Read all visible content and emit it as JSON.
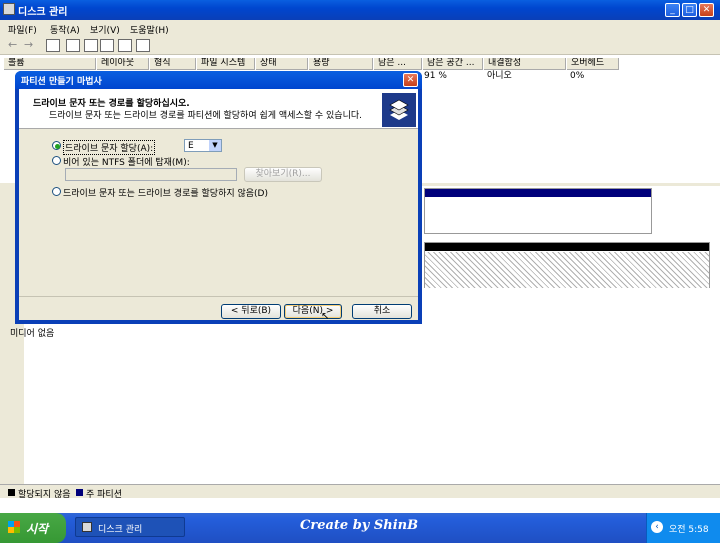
{
  "window": {
    "title": "디스크 관리",
    "minimize": "_",
    "maximize": "□",
    "close": "✕"
  },
  "menu": [
    "파일(F)",
    "동작(A)",
    "보기(V)",
    "도움말(H)"
  ],
  "volume_table": {
    "headers": [
      "볼륨",
      "레이아웃",
      "형식",
      "파일 시스템",
      "상태",
      "용량",
      "남은 ...",
      "남은 공간 ...",
      "내결함성",
      "오버헤드"
    ],
    "row": {
      "free_pct": "91 %",
      "fault_tolerance": "아니오",
      "overhead": "0%"
    }
  },
  "lower_pane": {
    "media_label": "미디어 없음"
  },
  "legend": {
    "unallocated": "할당되지 않음",
    "primary": "주 파티션"
  },
  "dialog": {
    "title": "파티션 만들기 마법사",
    "heading": "드라이브 문자 또는 경로를 할당하십시오.",
    "subheading": "드라이브 문자 또는 드라이브 경로를 파티션에 할당하여 쉽게 액세스할 수 있습니다.",
    "options": [
      {
        "label": "드라이브 문자 할당(A):",
        "selected": true
      },
      {
        "label": "비어 있는 NTFS 폴더에 탑재(M):",
        "selected": false
      },
      {
        "label": "드라이브 문자 또는 드라이브 경로를 할당하지 않음(D)",
        "selected": false
      }
    ],
    "drive_letter": "E",
    "browse_button": "찾아보기(R)...",
    "back_button": "< 뒤로(B)",
    "next_button": "다음(N) >",
    "cancel_button": "취소",
    "close": "✕"
  },
  "taskbar": {
    "start": "시작",
    "task_item": "디스크 관리",
    "banner": "Create by ShinB",
    "clock": "오전 5:58"
  },
  "colors": {
    "xp_blue": "#0a3fb7",
    "xp_face": "#ece9d8",
    "primary_partition": "#00007b",
    "start_green": "#3a9c37"
  }
}
